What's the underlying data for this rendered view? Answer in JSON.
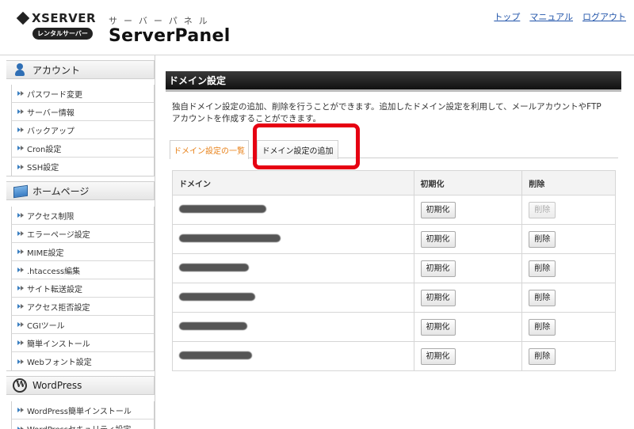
{
  "header": {
    "logo_brand": "XSERVER",
    "logo_sub": "レンタルサーバー",
    "panel_kana": "サーバーパネル",
    "panel_name": "ServerPanel",
    "links": [
      "トップ",
      "マニュアル",
      "ログアウト"
    ]
  },
  "sidebar": {
    "sections": [
      {
        "title": "アカウント",
        "icon": "person-icon",
        "items": [
          "パスワード変更",
          "サーバー情報",
          "バックアップ",
          "Cron設定",
          "SSH設定"
        ]
      },
      {
        "title": "ホームページ",
        "icon": "homepage-icon",
        "items": [
          "アクセス制限",
          "エラーページ設定",
          "MIME設定",
          ".htaccess編集",
          "サイト転送設定",
          "アクセス拒否設定",
          "CGIツール",
          "簡単インストール",
          "Webフォント設定"
        ]
      },
      {
        "title": "WordPress",
        "icon": "wordpress-icon",
        "items": [
          "WordPress簡単インストール",
          "WordPressセキュリティ設定"
        ]
      }
    ]
  },
  "main": {
    "title": "ドメイン設定",
    "description": "独自ドメイン設定の追加、削除を行うことができます。追加したドメイン設定を利用して、メールアカウントやFTPアカウントを作成することができます。",
    "tabs": {
      "list": "ドメイン設定の一覧",
      "add": "ドメイン設定の追加"
    },
    "table": {
      "headers": [
        "ドメイン",
        "初期化",
        "削除"
      ],
      "init_label": "初期化",
      "delete_label": "削除",
      "rows": [
        {
          "delete_enabled": false
        },
        {
          "delete_enabled": true
        },
        {
          "delete_enabled": true
        },
        {
          "delete_enabled": true
        },
        {
          "delete_enabled": true
        },
        {
          "delete_enabled": true
        }
      ]
    },
    "highlight_color": "#e60012",
    "active_tab_color": "#e8821a"
  }
}
